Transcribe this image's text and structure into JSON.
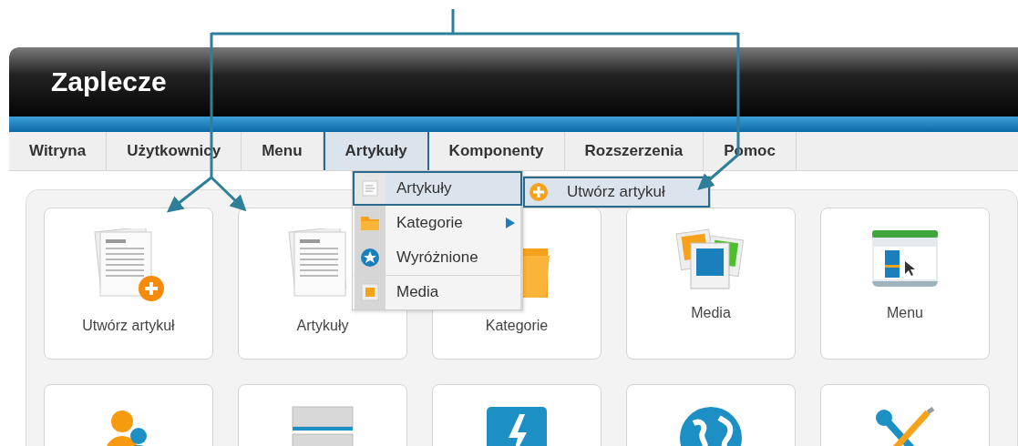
{
  "window": {
    "title": "Zaplecze"
  },
  "tabs": [
    {
      "label": "Witryna",
      "selected": false
    },
    {
      "label": "Użytkownicy",
      "selected": false
    },
    {
      "label": "Menu",
      "selected": false
    },
    {
      "label": "Artykuły",
      "selected": true
    },
    {
      "label": "Komponenty",
      "selected": false
    },
    {
      "label": "Rozszerzenia",
      "selected": false
    },
    {
      "label": "Pomoc",
      "selected": false
    }
  ],
  "dropdown": {
    "items": [
      {
        "label": "Artykuły",
        "kind": "article",
        "selected": true,
        "has_submenu": false,
        "divider_above": false
      },
      {
        "label": "Kategorie",
        "kind": "folder",
        "selected": false,
        "has_submenu": true,
        "divider_above": false
      },
      {
        "label": "Wyróżnione",
        "kind": "star",
        "selected": false,
        "has_submenu": false,
        "divider_above": false
      },
      {
        "label": "Media",
        "kind": "media",
        "selected": false,
        "has_submenu": false,
        "divider_above": true
      }
    ]
  },
  "submenu": {
    "items": [
      {
        "label": "Utwórz artykuł",
        "kind": "add",
        "selected": true
      }
    ]
  },
  "tiles": [
    {
      "label": "Utwórz artykuł",
      "kind": "add-article"
    },
    {
      "label": "Artykuły",
      "kind": "article"
    },
    {
      "label": "Kategorie",
      "kind": "folder"
    },
    {
      "label": "Media",
      "kind": "media"
    },
    {
      "label": "Menu",
      "kind": "menu"
    },
    {
      "kind": "users"
    },
    {
      "kind": "modules"
    },
    {
      "kind": "extensions"
    },
    {
      "kind": "languages"
    },
    {
      "kind": "tools"
    }
  ]
}
